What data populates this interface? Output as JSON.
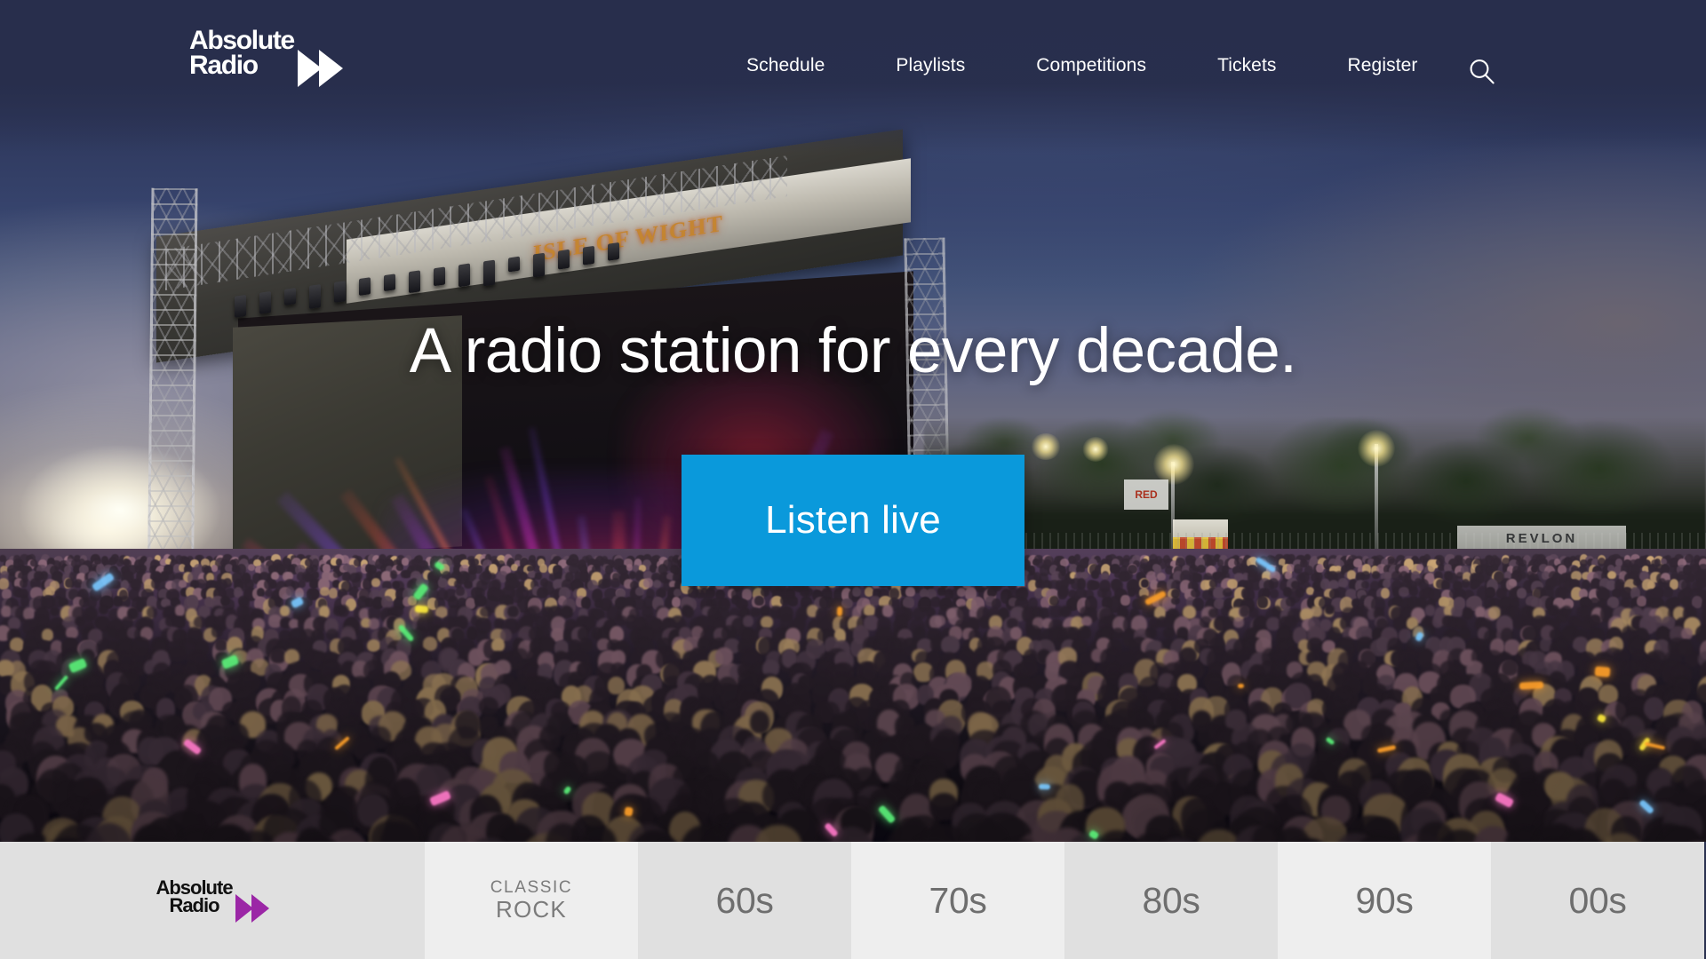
{
  "header": {
    "logo": {
      "line1": "Absolute",
      "line2": "Radio",
      "icon": "double-triangle-forward-icon"
    },
    "nav": [
      {
        "label": "Schedule"
      },
      {
        "label": "Playlists"
      },
      {
        "label": "Competitions"
      },
      {
        "label": "Tickets"
      },
      {
        "label": "Register"
      }
    ],
    "search_icon": "search-icon",
    "background_color": "#282e4c"
  },
  "hero": {
    "headline": "A radio station for every decade.",
    "cta_label": "Listen live",
    "cta_color": "#0a99db",
    "stage_banner_text": "ISLE OF WIGHT",
    "field_banner_text": "REVLON",
    "field_sign_text": "RED"
  },
  "station_bar": {
    "brand": {
      "line1": "Absolute",
      "line2": "Radio",
      "icon": "double-triangle-forward-icon",
      "arrow_color": "#9b26a6"
    },
    "stations": [
      {
        "id": "classic-rock",
        "line1": "CLASSIC",
        "line2": "ROCK",
        "shade": "light"
      },
      {
        "id": "60s",
        "label": "60s",
        "shade": "dark"
      },
      {
        "id": "70s",
        "label": "70s",
        "shade": "light"
      },
      {
        "id": "80s",
        "label": "80s",
        "shade": "dark"
      },
      {
        "id": "90s",
        "label": "90s",
        "shade": "light"
      },
      {
        "id": "00s",
        "label": "00s",
        "shade": "dark"
      }
    ]
  }
}
